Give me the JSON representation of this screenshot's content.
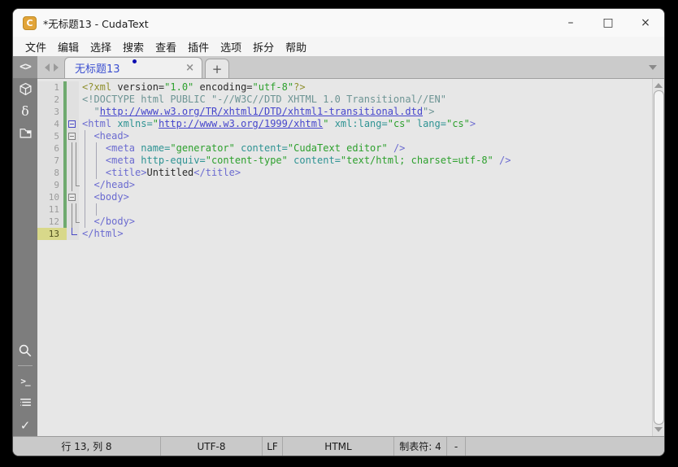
{
  "window": {
    "title": "*无标题13 - CudaText",
    "icon_letter": "C"
  },
  "titlebar_controls": {
    "minimize": "–",
    "maximize": "□",
    "close": "×"
  },
  "menu": {
    "items": [
      "文件",
      "编辑",
      "选择",
      "搜索",
      "查看",
      "插件",
      "选项",
      "拆分",
      "帮助"
    ]
  },
  "tabbar": {
    "tab": {
      "label": "无标题13",
      "modified": true,
      "close_glyph": "×"
    },
    "new_tab_label": "+"
  },
  "sidebar": {
    "top_icons": [
      "code-panel",
      "plugins-package",
      "snippets-delta",
      "project-folder"
    ],
    "bottom_icons": [
      "search",
      "console-terminal",
      "output-list",
      "validate-check"
    ],
    "glyphs": {
      "code": "<>",
      "delta": "δ",
      "terminal": ">_",
      "check": "✓"
    }
  },
  "editor": {
    "lines": [
      {
        "n": 1,
        "changed": true,
        "current": false,
        "fold": "",
        "tokens": [
          [
            "pi",
            "<?xml"
          ],
          [
            "plain",
            " version="
          ],
          [
            "str",
            "\"1.0\""
          ],
          [
            "plain",
            " encoding="
          ],
          [
            "str",
            "\"utf-8\""
          ],
          [
            "pi",
            "?>"
          ]
        ]
      },
      {
        "n": 2,
        "changed": true,
        "current": false,
        "fold": "",
        "tokens": [
          [
            "doctype",
            "<!DOCTYPE html PUBLIC \"-//W3C//DTD XHTML 1.0 Transitional//EN\""
          ]
        ]
      },
      {
        "n": 3,
        "changed": true,
        "current": false,
        "fold": "",
        "tokens": [
          [
            "doctype",
            "  \""
          ],
          [
            "link",
            "http://www.w3.org/TR/xhtml1/DTD/xhtml1-transitional.dtd"
          ],
          [
            "doctype",
            "\">"
          ]
        ]
      },
      {
        "n": 4,
        "changed": true,
        "current": false,
        "fold": "boxA",
        "tokens": [
          [
            "tag",
            "<html"
          ],
          [
            "attr",
            " xmlns="
          ],
          [
            "str",
            "\""
          ],
          [
            "link",
            "http://www.w3.org/1999/xhtml"
          ],
          [
            "str",
            "\""
          ],
          [
            "attr",
            " xml:lang="
          ],
          [
            "str",
            "\"cs\""
          ],
          [
            "attr",
            " lang="
          ],
          [
            "str",
            "\"cs\""
          ],
          [
            "tag",
            ">"
          ]
        ]
      },
      {
        "n": 5,
        "changed": true,
        "current": false,
        "fold": "box",
        "tokens": [
          [
            "tag",
            "  <head>"
          ]
        ]
      },
      {
        "n": 6,
        "changed": true,
        "current": false,
        "fold": "vv",
        "tokens": [
          [
            "tag",
            "    <meta"
          ],
          [
            "attr",
            " name="
          ],
          [
            "str",
            "\"generator\""
          ],
          [
            "attr",
            " content="
          ],
          [
            "str",
            "\"CudaText editor\""
          ],
          [
            "tag",
            " />"
          ]
        ]
      },
      {
        "n": 7,
        "changed": true,
        "current": false,
        "fold": "vv",
        "tokens": [
          [
            "tag",
            "    <meta"
          ],
          [
            "attr",
            " http-equiv="
          ],
          [
            "str",
            "\"content-type\""
          ],
          [
            "attr",
            " content="
          ],
          [
            "str",
            "\"text/html; charset=utf-8\""
          ],
          [
            "tag",
            " />"
          ]
        ]
      },
      {
        "n": 8,
        "changed": true,
        "current": false,
        "fold": "vv",
        "tokens": [
          [
            "tag",
            "    <title>"
          ],
          [
            "plain",
            "Untitled"
          ],
          [
            "tag",
            "</title>"
          ]
        ]
      },
      {
        "n": 9,
        "changed": true,
        "current": false,
        "fold": "vL",
        "tokens": [
          [
            "tag",
            "  </head>"
          ]
        ]
      },
      {
        "n": 10,
        "changed": true,
        "current": false,
        "fold": "box",
        "tokens": [
          [
            "tag",
            "  <body>"
          ]
        ]
      },
      {
        "n": 11,
        "changed": true,
        "current": false,
        "fold": "vv",
        "tokens": []
      },
      {
        "n": 12,
        "changed": true,
        "current": false,
        "fold": "vL",
        "tokens": [
          [
            "tag",
            "  </body>"
          ]
        ]
      },
      {
        "n": 13,
        "changed": false,
        "current": true,
        "fold": "endA",
        "tokens": [
          [
            "tag",
            "</html>"
          ]
        ]
      }
    ]
  },
  "statusbar": {
    "cells": [
      {
        "name": "cursor-position",
        "label": "行 13, 列 8"
      },
      {
        "name": "encoding",
        "label": "UTF-8"
      },
      {
        "name": "line-endings",
        "label": "LF"
      },
      {
        "name": "lexer",
        "label": "HTML"
      },
      {
        "name": "tab-size",
        "label": "制表符: 4"
      },
      {
        "name": "insert-mode",
        "label": "-"
      },
      {
        "name": "message-area",
        "label": ""
      }
    ]
  },
  "colors": {
    "accent_tab_text": "#3b4fd0",
    "modified_dot": "#0c0cb0",
    "changed_marker_green": "#6faa6f",
    "current_line_gutter": "#d8d88a",
    "app_icon_amber": "#e2a438"
  }
}
